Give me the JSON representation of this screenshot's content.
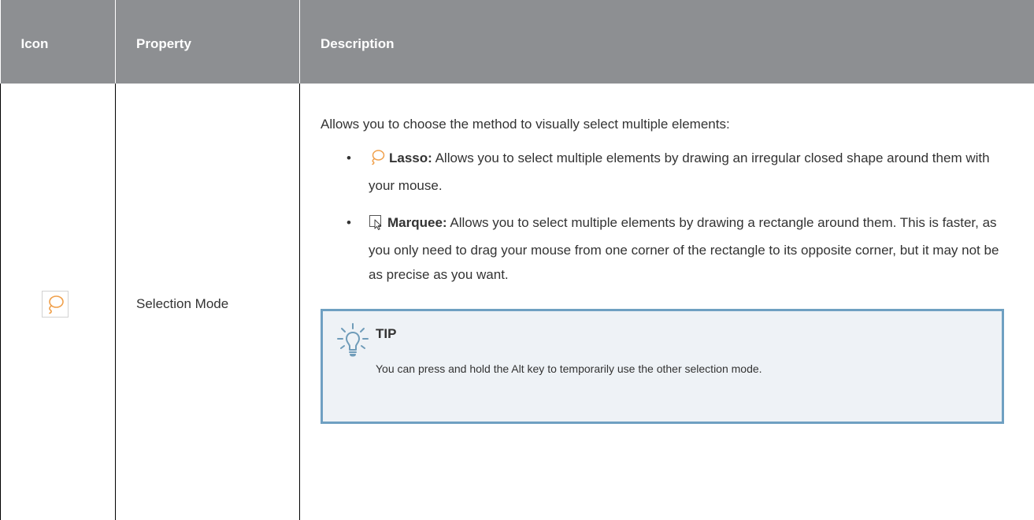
{
  "table": {
    "headers": {
      "icon": "Icon",
      "property": "Property",
      "description": "Description"
    },
    "row": {
      "icon_name": "lasso-icon",
      "property": "Selection Mode",
      "intro": "Allows you to choose the method to visually select multiple elements:",
      "bullets": [
        {
          "icon_name": "lasso-icon",
          "term": "Lasso:",
          "text": " Allows you to select multiple elements by drawing an irregular closed shape around them with your mouse."
        },
        {
          "icon_name": "marquee-icon",
          "term": "Marquee:",
          "text": " Allows you to select multiple elements by drawing a rectangle around them. This is faster, as you only need to drag your mouse from one corner of the rectangle to its opposite corner, but it may not be as precise as you want."
        }
      ],
      "tip": {
        "icon_name": "lightbulb-icon",
        "title": "TIP",
        "text": "You can press and hold the Alt key to temporarily use the other selection mode."
      }
    }
  },
  "colors": {
    "header_bg": "#8d8f92",
    "header_text": "#ffffff",
    "lasso_orange": "#f0a04b",
    "tip_border": "#6fa0c2",
    "tip_bg": "#eef2f6",
    "tip_icon": "#6f9cb9",
    "bullet_symbol": "•"
  }
}
